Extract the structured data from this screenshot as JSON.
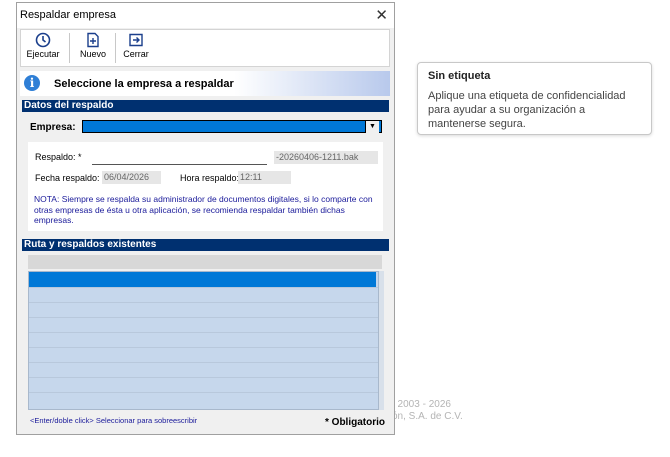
{
  "background": {
    "copyright_line1": "t 2003 - 2026",
    "copyright_line2": "ón, S.A. de C.V."
  },
  "tooltip": {
    "title": "Sin etiqueta",
    "body": "Aplique una etiqueta de confidencialidad para ayudar a su organización a mantenerse segura."
  },
  "window": {
    "title": "Respaldar empresa",
    "close_glyph": "✕"
  },
  "toolbar": {
    "ejecutar_label": "Ejecutar",
    "nuevo_label": "Nuevo",
    "cerrar_label": "Cerrar",
    "ejecutar_icon": "clock-icon",
    "nuevo_icon": "new-document-icon",
    "cerrar_icon": "exit-icon"
  },
  "banner": {
    "text": "Seleccione la empresa a respaldar",
    "icon": "info-icon"
  },
  "datos": {
    "section_title": "Datos del respaldo",
    "empresa_label": "Empresa:",
    "empresa_value": "",
    "respaldo_label": "Respaldo: *",
    "respaldo_value": "",
    "respaldo_suffix": "-20260406-1211.bak",
    "fecha_label": "Fecha respaldo:",
    "fecha_value": "06/04/2026",
    "hora_label": "Hora respaldo:",
    "hora_value": "12:11",
    "note": "NOTA: Siempre se respalda su administrador de documentos digitales, si lo comparte con otras empresas de ésta u otra aplicación, se recomienda respaldar también dichas empresas."
  },
  "ruta": {
    "section_title": "Ruta y respaldos existentes"
  },
  "footer": {
    "hint": "<Enter/doble click> Seleccionar para sobreescribir",
    "required": "* Obligatorio"
  },
  "colors": {
    "section_bg": "#003070",
    "selection": "#0078d7",
    "grid_bg": "#c6d7ec",
    "note_text": "#1a1a9a"
  }
}
